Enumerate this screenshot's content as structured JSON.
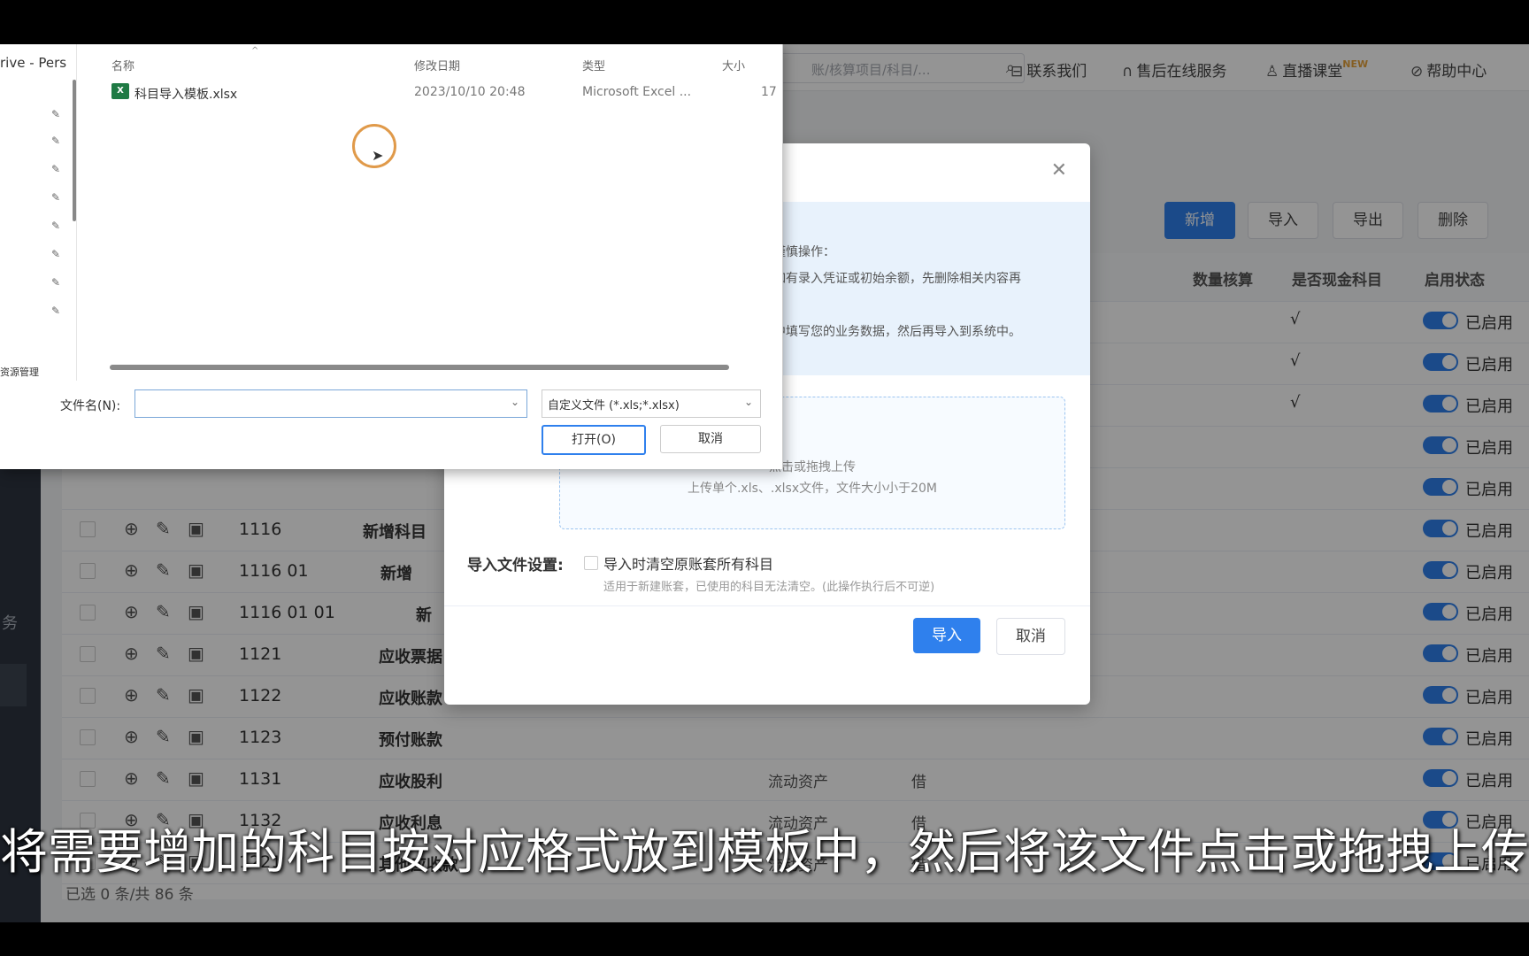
{
  "header": {
    "search_placeholder": "账/核算项目/科目/...",
    "links": [
      "联系我们",
      "售后在线服务",
      "直播课堂",
      "帮助中心"
    ],
    "new_badge": "NEW"
  },
  "toolbar": [
    "新增",
    "导入",
    "导出",
    "删除"
  ],
  "table": {
    "columns": [
      "数量核算",
      "是否现金科目",
      "启用状态"
    ],
    "rows": [
      {
        "code": "1116",
        "name": "新增科目",
        "category": "",
        "direction": "",
        "cash": ""
      },
      {
        "code": "1116 01",
        "name": "新增",
        "category": "",
        "direction": "",
        "cash": ""
      },
      {
        "code": "1116 01 01",
        "name": "新",
        "category": "",
        "direction": "",
        "cash": ""
      },
      {
        "code": "1121",
        "name": "应收票据",
        "category": "",
        "direction": "",
        "cash": ""
      },
      {
        "code": "1122",
        "name": "应收账款",
        "category": "",
        "direction": "",
        "cash": ""
      },
      {
        "code": "1123",
        "name": "预付账款",
        "category": "",
        "direction": "",
        "cash": ""
      },
      {
        "code": "1131",
        "name": "应收股利",
        "category": "流动资产",
        "direction": "借",
        "cash": ""
      },
      {
        "code": "1132",
        "name": "应收利息",
        "category": "流动资产",
        "direction": "借",
        "cash": ""
      },
      {
        "code": "1221",
        "name": "其他应收款",
        "category": "流动资产",
        "direction": "借",
        "cash": ""
      }
    ],
    "upper_rows_cash": [
      "√",
      "√",
      "√",
      "",
      ""
    ],
    "status_label": "已启用",
    "footer": "已选 0 条/共 86 条"
  },
  "sidebar_text": "务",
  "import_dialog": {
    "notice_line1": "谨慎操作：",
    "notice_line2": "如有录入凭证或初始余额，先删除相关内容再",
    "notice_line3": "中填写您的业务数据，然后再导入到系统中。",
    "upload_line1": "点击或拖拽上传",
    "upload_line2": "上传单个.xls、.xlsx文件，文件大小小于20M",
    "setting_label": "导入文件设置:",
    "checkbox_label": "导入时清空原账套所有科目",
    "hint": "适用于新建账套，已使用的科目无法清空。(此操作执行后不可逆)",
    "import_button": "导入",
    "cancel_button": "取消"
  },
  "file_dialog": {
    "nav_drive": "rive - Pers",
    "nav_label": "资源管理",
    "columns": {
      "name": "名称",
      "modified": "修改日期",
      "type": "类型",
      "size": "大小"
    },
    "file": {
      "name": "科目导入模板.xlsx",
      "modified": "2023/10/10 20:48",
      "type": "Microsoft Excel ...",
      "size": "17"
    },
    "filename_label": "文件名(N):",
    "filename_value": "",
    "filter": "自定义文件 (*.xls;*.xlsx)",
    "open_button": "打开(O)",
    "cancel_button": "取消"
  },
  "subtitle": "将需要增加的科目按对应格式放到模板中，然后将该文件点击或拖拽上传"
}
